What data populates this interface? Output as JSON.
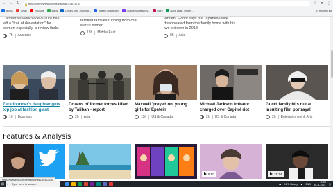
{
  "browser": {
    "url": "bbc.com/news/world/us-canada-57673741",
    "bookmarks": [
      {
        "label": "Books",
        "color": "#1a73e8"
      },
      {
        "label": "Gmail",
        "color": "#ea4335"
      },
      {
        "label": "YouTube",
        "color": "#ff0000"
      },
      {
        "label": "Maps",
        "color": "#34a853"
      },
      {
        "label": "Linked Jobs - Informa...",
        "color": "#0a66c2"
      },
      {
        "label": "Indeed: Dashboard",
        "color": "#2164f3"
      },
      {
        "label": "Culture Shaftesbury...",
        "color": "#7c3aed"
      },
      {
        "label": "Nitro",
        "color": "#c2185b"
      },
      {
        "label": "Nova Labs - Offices...",
        "color": "#0f9d58"
      }
    ],
    "reading_list": "Reading list"
  },
  "top_stories": [
    {
      "text": "Canberra's workplace culture has left a \"trail of devastation\" for women especially, a review finds.",
      "time": "7h",
      "category": "Australia"
    },
    {
      "text": "terrified families running from civil war in Yemen.",
      "time": "13h",
      "category": "Middle East"
    },
    {
      "text": "Vincent Fichot says his Japanese wife disappeared from the family home with his two children in 2018.",
      "time": "8h",
      "category": "Asia"
    }
  ],
  "cards": [
    {
      "title": "Zara founder's daughter gets top job at fashion giant",
      "time": "1h",
      "category": "Business",
      "hovered": true
    },
    {
      "title": "Dozens of former forces killed by Taliban - report",
      "time": "2h",
      "category": "Asia",
      "hovered": false
    },
    {
      "title": "Maxwell 'preyed on' young girls for Epstein",
      "time": "15h",
      "category": "US & Canada",
      "hovered": false
    },
    {
      "title": "Michael Jackson imitator charged over Capitol riot",
      "time": "2h",
      "category": "US & Canada",
      "hovered": false
    },
    {
      "title": "Gucci family hits out at insulting film portrayal",
      "time": "2h",
      "category": "Entertainment & Arts",
      "hovered": false
    }
  ],
  "features": {
    "heading": "Features & Analysis",
    "items": [
      {
        "duration": ""
      },
      {
        "duration": ""
      },
      {
        "duration": ""
      },
      {
        "duration": "5:00"
      },
      {
        "duration": "15:14"
      }
    ]
  },
  "status_url": "https://www.bbc.com/news/business-59441536",
  "taskbar": {
    "search_placeholder": "Type here to search",
    "weather": "24°C Cloudy",
    "language": "ENG",
    "time": "11:05",
    "date": "30-11-2021"
  }
}
